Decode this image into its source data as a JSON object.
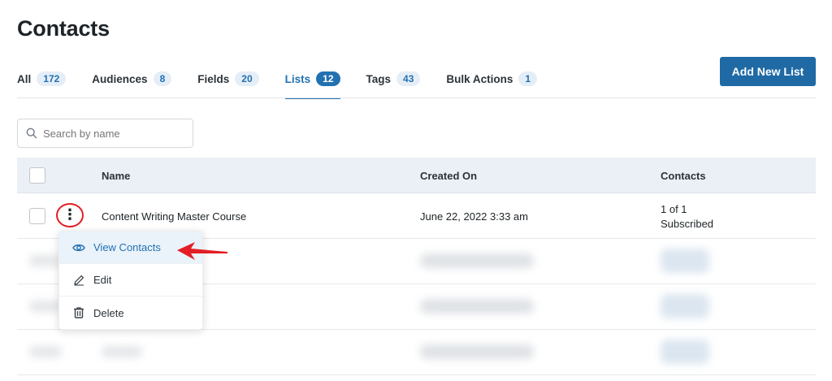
{
  "page": {
    "title": "Contacts"
  },
  "tabs": [
    {
      "label": "All",
      "count": "172"
    },
    {
      "label": "Audiences",
      "count": "8"
    },
    {
      "label": "Fields",
      "count": "20"
    },
    {
      "label": "Lists",
      "count": "12",
      "active": true
    },
    {
      "label": "Tags",
      "count": "43"
    },
    {
      "label": "Bulk Actions",
      "count": "1"
    }
  ],
  "actions": {
    "add_label": "Add New List"
  },
  "search": {
    "placeholder": "Search by name"
  },
  "table": {
    "headers": {
      "name": "Name",
      "created": "Created On",
      "contacts": "Contacts"
    },
    "rows": [
      {
        "name": "Content Writing Master Course",
        "created": "June 22, 2022 3:33 am",
        "contacts_count": "1 of 1",
        "contacts_status": "Subscribed"
      }
    ]
  },
  "menu": {
    "items": [
      {
        "label": "View Contacts",
        "icon": "eye-icon"
      },
      {
        "label": "Edit",
        "icon": "pencil-icon"
      },
      {
        "label": "Delete",
        "icon": "trash-icon"
      }
    ]
  },
  "colors": {
    "accent": "#2271b1",
    "button": "#1f6aa5",
    "annotation": "#e31e24",
    "header_bg": "#eaf0f6"
  }
}
